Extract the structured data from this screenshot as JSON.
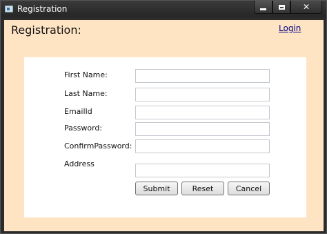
{
  "window": {
    "title": "Registration"
  },
  "header": {
    "heading": "Registration:",
    "login_link": "Login"
  },
  "form": {
    "first_name_label": "First Name:",
    "last_name_label": "Last Name:",
    "email_label": "EmailId",
    "password_label": "Password:",
    "confirm_password_label": "ConfirmPassword:",
    "address_label": "Address",
    "first_name_value": "",
    "last_name_value": "",
    "email_value": "",
    "password_value": "",
    "confirm_password_value": "",
    "address_value": ""
  },
  "buttons": {
    "submit": "Submit",
    "reset": "Reset",
    "cancel": "Cancel"
  }
}
